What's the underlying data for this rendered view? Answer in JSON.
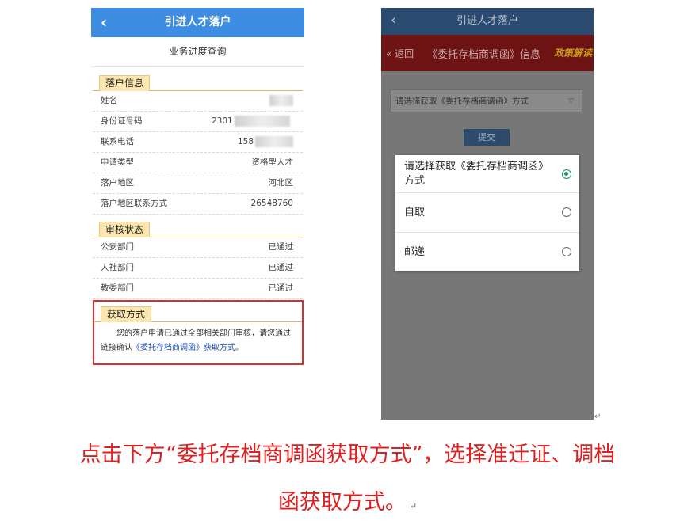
{
  "left_phone": {
    "header_title": "引进人才落户",
    "back_glyph": "‹",
    "subtitle": "业务进度查询",
    "section_info": {
      "title": "落户信息",
      "rows": [
        {
          "label": "姓名",
          "value": "",
          "redacted": true
        },
        {
          "label": "身份证号码",
          "value": "2301",
          "redacted": true
        },
        {
          "label": "联系电话",
          "value": "158",
          "redacted": true
        },
        {
          "label": "申请类型",
          "value": "资格型人才"
        },
        {
          "label": "落户地区",
          "value": "河北区"
        },
        {
          "label": "落户地区联系方式",
          "value": "26548760"
        }
      ]
    },
    "section_review": {
      "title": "审核状态",
      "rows": [
        {
          "label": "公安部门",
          "value": "已通过"
        },
        {
          "label": "人社部门",
          "value": "已通过"
        },
        {
          "label": "教委部门",
          "value": "已通过"
        }
      ]
    },
    "section_get": {
      "title": "获取方式",
      "text_before": "您的落户申请已通过全部相关部门审核，请您通过链接确认",
      "link": "《委托存档商调函》获取方式",
      "text_after": "。"
    }
  },
  "right_phone": {
    "header_title": "引进人才落户",
    "back_glyph": "‹",
    "bar_back": "« 返回",
    "bar_title": "《委托存档商调函》信息",
    "bar_tag": "政策解读",
    "select_placeholder": "请选择获取《委托存档商调函》方式",
    "select_caret": "▽",
    "submit_label": "提交",
    "dialog": {
      "options": [
        {
          "label": "请选择获取《委托存档商调函》方式",
          "selected": true
        },
        {
          "label": "自取",
          "selected": false
        },
        {
          "label": "邮递",
          "selected": false
        }
      ]
    }
  },
  "return_mark": "↵",
  "caption": {
    "line1": "点击下方“委托存档商调函获取方式”，选择准迁证、调档",
    "line2": "函获取方式。"
  },
  "colors": {
    "left_header": "#3d8ee3",
    "caption_red": "#e02020",
    "highlight_border": "#e02b2b",
    "radio_selected": "#1a8f6a"
  }
}
